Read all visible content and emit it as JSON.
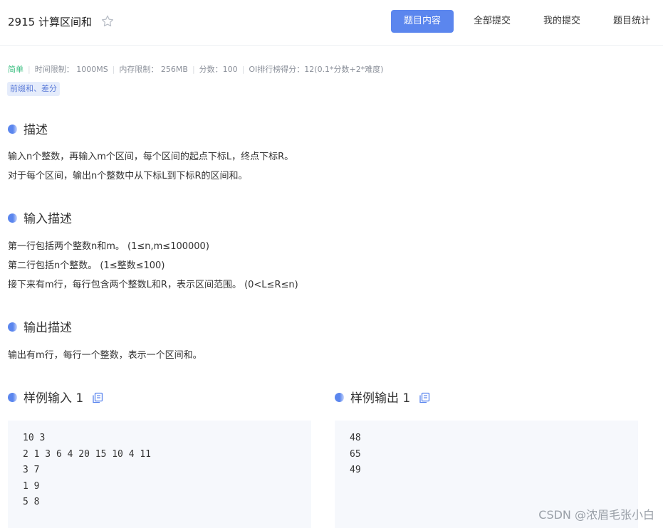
{
  "problem": {
    "title": "2915 计算区间和"
  },
  "tabs": [
    {
      "label": "题目内容",
      "active": true
    },
    {
      "label": "全部提交",
      "active": false
    },
    {
      "label": "我的提交",
      "active": false
    },
    {
      "label": "题目统计",
      "active": false
    }
  ],
  "meta": {
    "level": "简单",
    "time_limit": "时间限制： 1000MS",
    "memory_limit": "内存限制： 256MB",
    "score": "分数：100",
    "oi_score": "OI排行榜得分：12(0.1*分数+2*难度)"
  },
  "tags": [
    "前缀和、差分"
  ],
  "sections": {
    "description": {
      "title": "描述",
      "lines": [
        "输入n个整数，再输入m个区间，每个区间的起点下标L，终点下标R。",
        "对于每个区间，输出n个整数中从下标L到下标R的区间和。"
      ]
    },
    "input": {
      "title": "输入描述",
      "lines": [
        "第一行包括两个整数n和m。 (1≤n,m≤100000)",
        "第二行包括n个整数。 (1≤整数≤100)",
        "接下来有m行，每行包含两个整数L和R，表示区间范围。 (0<L≤R≤n)"
      ]
    },
    "output": {
      "title": "输出描述",
      "lines": [
        "输出有m行，每行一个整数，表示一个区间和。"
      ]
    },
    "sample_input": {
      "title": "样例输入 1",
      "lines": [
        "10 3",
        "2 1 3 6 4 20 15 10 4 11",
        "3 7",
        "1 9",
        "5 8"
      ]
    },
    "sample_output": {
      "title": "样例输出 1",
      "lines": [
        "48",
        "65",
        "49"
      ]
    }
  },
  "watermark": "CSDN @浓眉毛张小白",
  "colors": {
    "accent": "#5b86ee",
    "level_easy": "#3dbf82",
    "tag_bg": "#e5ecfb",
    "code_bg": "#f6f8fc"
  },
  "icons": {
    "favorite": "star-outline-icon",
    "copy": "copy-icon",
    "bullet": "section-dot-icon"
  }
}
